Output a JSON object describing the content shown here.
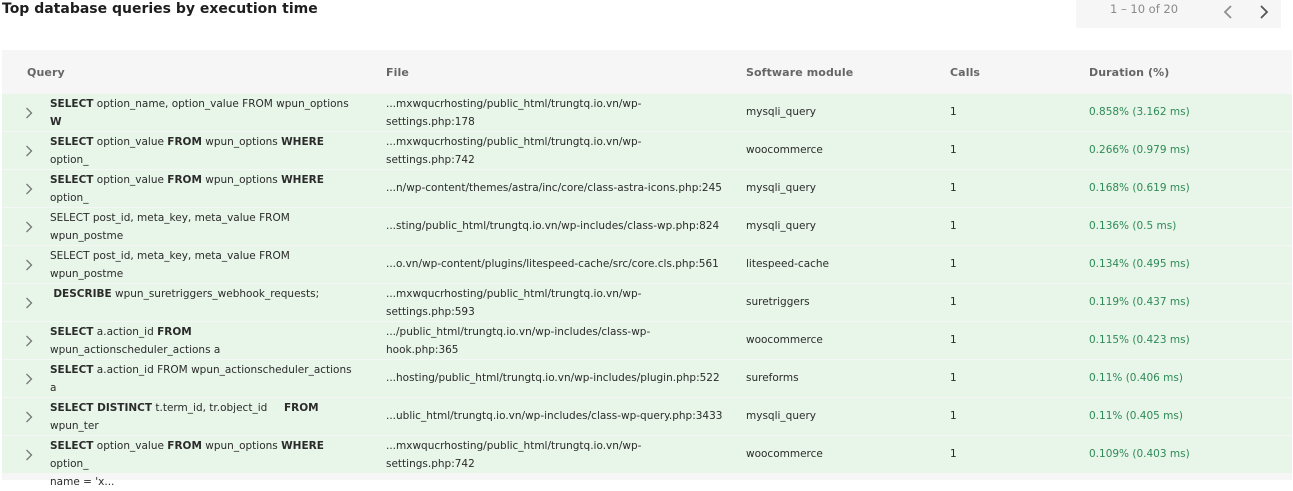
{
  "title": "Top database queries by execution time",
  "pagination": {
    "range": "1 – 10 of 20",
    "prev_icon": "chevron-left-icon",
    "next_icon": "chevron-right-icon"
  },
  "columns": [
    "Query",
    "File",
    "Software module",
    "Calls",
    "Duration (%)"
  ],
  "rows": [
    {
      "query_html": "<b>SELECT</b> option_name, option_value FROM wpun_options <b>W</b><br><b>HERE</b> aut...",
      "file": "...mxwqucrhosting/public_html/trungtq.io.vn/wp-\nsettings.php:178",
      "module": "mysqli_query",
      "calls": "1",
      "duration": "0.858% (3.162 ms)"
    },
    {
      "query_html": "<b>SELECT</b> option_value <b>FROM</b> wpun_options <b>WHERE</b> option_<br>name = 'x...",
      "file": "...mxwqucrhosting/public_html/trungtq.io.vn/wp-\nsettings.php:742",
      "module": "woocommerce",
      "calls": "1",
      "duration": "0.266% (0.979 ms)"
    },
    {
      "query_html": "<b>SELECT</b> option_value <b>FROM</b> wpun_options <b>WHERE</b> option_<br>name = 'x...",
      "file": "...n/wp-content/themes/astra/inc/core/class-astra-icons.php:245",
      "module": "mysqli_query",
      "calls": "1",
      "duration": "0.168% (0.619 ms)"
    },
    {
      "query_html": "SELECT post_id, meta_key, meta_value FROM wpun_postme<br>ta WHER...",
      "file": "...sting/public_html/trungtq.io.vn/wp-includes/class-wp.php:824",
      "module": "mysqli_query",
      "calls": "1",
      "duration": "0.136% (0.5 ms)"
    },
    {
      "query_html": "SELECT post_id, meta_key, meta_value FROM wpun_postme<br>ta WHER...",
      "file": "...o.vn/wp-content/plugins/litespeed-cache/src/core.cls.php:561",
      "module": "litespeed-cache",
      "calls": "1",
      "duration": "0.134% (0.495 ms)"
    },
    {
      "query_html": "&nbsp;<b>DESCRIBE</b> wpun_suretriggers_webhook_requests;",
      "file": "...mxwqucrhosting/public_html/trungtq.io.vn/wp-\nsettings.php:593",
      "module": "suretriggers",
      "calls": "1",
      "duration": "0.119% (0.437 ms)"
    },
    {
      "query_html": "<b>SELECT</b> a.action_id <b>FROM</b> wpun_actionscheduler_actions a<br><b>LEFT</b> ...",
      "file": ".../public_html/trungtq.io.vn/wp-includes/class-wp-\nhook.php:365",
      "module": "woocommerce",
      "calls": "1",
      "duration": "0.115% (0.423 ms)"
    },
    {
      "query_html": "<b>SELECT</b> a.action_id FROM wpun_actionscheduler_actions a<br><b>WHERE</b>...",
      "file": "...hosting/public_html/trungtq.io.vn/wp-includes/plugin.php:522",
      "module": "sureforms",
      "calls": "1",
      "duration": "0.11% (0.406 ms)"
    },
    {
      "query_html": "<b>SELECT DISTINCT</b> t.term_id, tr.object_id &nbsp;&nbsp;&nbsp;&nbsp;<b>FROM</b> wpun_ter<br>ms ...",
      "file": "...ublic_html/trungtq.io.vn/wp-includes/class-wp-query.php:3433",
      "module": "mysqli_query",
      "calls": "1",
      "duration": "0.11% (0.405 ms)"
    },
    {
      "query_html": "<b>SELECT</b> option_value <b>FROM</b> wpun_options <b>WHERE</b> option_<br>name = 'x...",
      "file": "...mxwqucrhosting/public_html/trungtq.io.vn/wp-\nsettings.php:742",
      "module": "woocommerce",
      "calls": "1",
      "duration": "0.109% (0.403 ms)"
    }
  ]
}
